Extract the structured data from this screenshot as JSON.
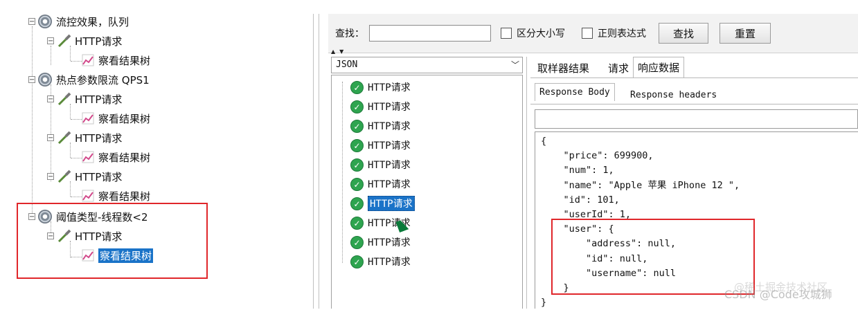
{
  "tree": {
    "items": [
      {
        "label": "流控效果，队列",
        "type": "thread-group"
      },
      {
        "label": "HTTP请求",
        "type": "sampler"
      },
      {
        "label": "察看结果树",
        "type": "listener"
      },
      {
        "label": "热点参数限流 QPS1",
        "type": "thread-group"
      },
      {
        "label": "HTTP请求",
        "type": "sampler"
      },
      {
        "label": "察看结果树",
        "type": "listener"
      },
      {
        "label": "HTTP请求",
        "type": "sampler"
      },
      {
        "label": "察看结果树",
        "type": "listener"
      },
      {
        "label": "HTTP请求",
        "type": "sampler"
      },
      {
        "label": "察看结果树",
        "type": "listener"
      },
      {
        "label": "阈值类型-线程数<2",
        "type": "thread-group"
      },
      {
        "label": "HTTP请求",
        "type": "sampler"
      },
      {
        "label": "察看结果树",
        "type": "listener",
        "selected": true
      }
    ]
  },
  "search": {
    "label": "查找：",
    "value": "",
    "case_sensitive_label": "区分大小写",
    "regex_label": "正则表达式",
    "find_button": "查找",
    "reset_button": "重置"
  },
  "renderer": {
    "selected": "JSON"
  },
  "results": {
    "items": [
      {
        "label": "HTTP请求"
      },
      {
        "label": "HTTP请求"
      },
      {
        "label": "HTTP请求"
      },
      {
        "label": "HTTP请求"
      },
      {
        "label": "HTTP请求"
      },
      {
        "label": "HTTP请求"
      },
      {
        "label": "HTTP请求",
        "selected": true
      },
      {
        "label": "HTTP请求"
      },
      {
        "label": "HTTP请求"
      },
      {
        "label": "HTTP请求"
      }
    ]
  },
  "tabs": [
    {
      "label": "取样器结果"
    },
    {
      "label": "请求"
    },
    {
      "label": "响应数据",
      "active": true
    }
  ],
  "subtabs": [
    {
      "label": "Response Body",
      "active": true
    },
    {
      "label": "Response headers"
    }
  ],
  "response_body": "{\n    \"price\": 699900,\n    \"num\": 1,\n    \"name\": \"Apple 苹果 iPhone 12 \",\n    \"id\": 101,\n    \"userId\": 1,\n    \"user\": {\n        \"address\": null,\n        \"id\": null,\n        \"username\": null\n    }\n}",
  "watermark": {
    "line1": "@稀土掘金技术社区",
    "line2": "CSDN @Code攻城狮"
  },
  "colors": {
    "highlight_box": "#e0262a",
    "selection": "#1a73c8",
    "success_icon": "#2ea44f"
  }
}
